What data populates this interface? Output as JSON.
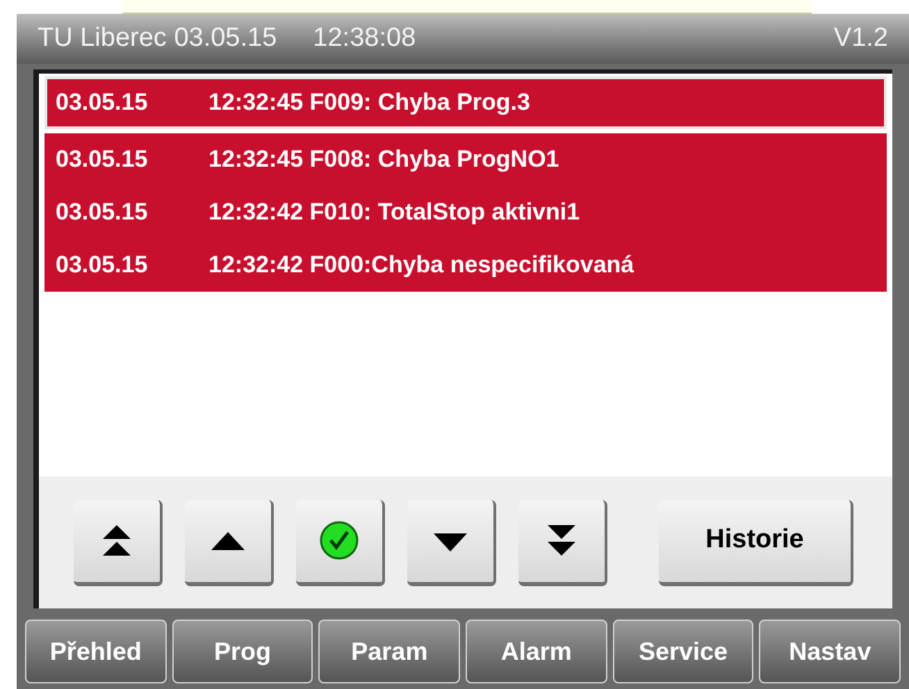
{
  "header": {
    "title": "TU Liberec 03.05.15",
    "time": "12:38:08",
    "version": "V1.2"
  },
  "alarms": [
    {
      "date": "03.05.15",
      "text": "12:32:45 F009: Chyba Prog.3",
      "selected": true
    },
    {
      "date": "03.05.15",
      "text": "12:32:45 F008: Chyba ProgNO1",
      "selected": false
    },
    {
      "date": "03.05.15",
      "text": "12:32:42 F010: TotalStop aktivni1",
      "selected": false
    },
    {
      "date": "03.05.15",
      "text": "12:32:42 F000:Chyba nespecifikovaná",
      "selected": false
    }
  ],
  "controls": [
    {
      "kind": "first"
    },
    {
      "kind": "up"
    },
    {
      "kind": "acknowledge"
    },
    {
      "kind": "down"
    },
    {
      "kind": "last"
    }
  ],
  "history_button": "Historie",
  "nav_tabs": [
    "Přehled",
    "Prog",
    "Param",
    "Alarm",
    "Service",
    "Nastav"
  ]
}
